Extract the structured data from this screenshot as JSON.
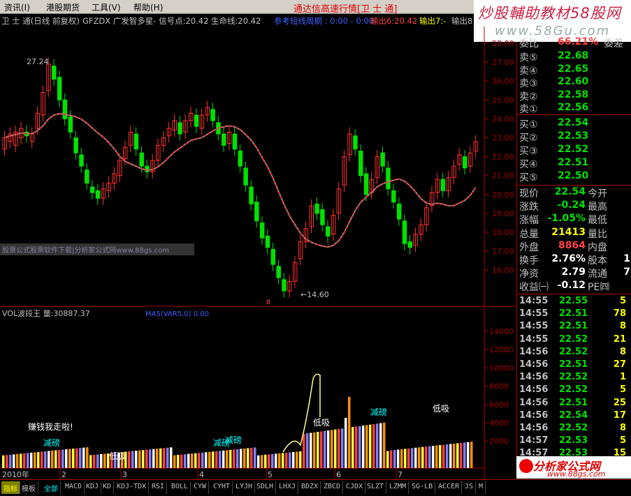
{
  "menu": [
    {
      "label": "资讯(I)"
    },
    {
      "label": "港股期货"
    },
    {
      "label": "工具(V)"
    },
    {
      "label": "帮助(H)"
    }
  ],
  "app_title": "通达信高速行情[卫 士 通]",
  "watermark": {
    "line1": "炒股輔助教材58股网",
    "line2": "www.58Gu.com"
  },
  "chart_header": {
    "stock": "卫 士 通(日线 前复权)",
    "formula": "GFZDX 广发智多星- 信号点:20.42 生命线:20.42",
    "blue_text": "参考短线周期 : 0:00 - 0:00",
    "sell1": "输出6:20.42",
    "sell2": "输出7:-",
    "sell3": "输出8"
  },
  "price_axis": [
    "28.00",
    "27.00",
    "26.00",
    "25.00",
    "24.00",
    "23.00",
    "22.00",
    "21.00",
    "20.00",
    "19.00",
    "18.00",
    "17.00",
    "16.00"
  ],
  "vol_axis": [
    "14000",
    "12000",
    "10000",
    "8000",
    "6000",
    "4000",
    "2000"
  ],
  "annotations": {
    "high_label": "27.24",
    "low_label": "←14.60",
    "ad_text": "股票公式股票软件下载|分析家公式网www.88gs.com",
    "vol_title": "VOL波段王 量:30887.37",
    "vol_blue": "MA5(VAR5,0) 0.00",
    "year": "2010年",
    "months": [
      "2",
      "3",
      "4",
      "5",
      "6",
      "7"
    ],
    "b_mark": "B",
    "vol_texts": [
      {
        "text": "赚钱我走啦!",
        "color": "#ffffff"
      },
      {
        "text": "减磅",
        "color": "#00ffff"
      },
      {
        "text": "低吸",
        "color": "#ffffff"
      },
      {
        "text": "减磅",
        "color": "#00ffff"
      },
      {
        "text": "减磅",
        "color": "#00ffff"
      },
      {
        "text": "低吸",
        "color": "#ffffff"
      },
      {
        "text": "减磅",
        "color": "#00ffff"
      },
      {
        "text": "低吸",
        "color": "#ffffff"
      }
    ]
  },
  "quote": {
    "ratio_label": "委比",
    "ratio_value": "66.21%",
    "ratio_diff": "委差",
    "asks": [
      {
        "label": "卖⑤",
        "price": "22.68"
      },
      {
        "label": "卖④",
        "price": "22.65"
      },
      {
        "label": "卖③",
        "price": "22.60"
      },
      {
        "label": "卖②",
        "price": "22.58"
      },
      {
        "label": "卖①",
        "price": "22.56"
      }
    ],
    "bids": [
      {
        "label": "买①",
        "price": "22.54"
      },
      {
        "label": "买②",
        "price": "22.53"
      },
      {
        "label": "买③",
        "price": "22.52"
      },
      {
        "label": "买④",
        "price": "22.51"
      },
      {
        "label": "买⑤",
        "price": "22.50"
      }
    ],
    "stats": [
      {
        "l1": "现价",
        "v1": "22.54",
        "c1": "green",
        "l2": "今开"
      },
      {
        "l1": "涨跌",
        "v1": "-0.24",
        "c1": "green",
        "l2": "最高"
      },
      {
        "l1": "涨幅",
        "v1": "-1.05%",
        "c1": "green",
        "l2": "最低"
      },
      {
        "l1": "总量",
        "v1": "21413",
        "c1": "yellow",
        "l2": "量比"
      },
      {
        "l1": "外盘",
        "v1": "8864",
        "c1": "red",
        "l2": "内盘"
      },
      {
        "l1": "换手",
        "v1": "2.76%",
        "c1": "white",
        "l2": "股本",
        "v2": "1"
      },
      {
        "l1": "净资",
        "v1": "2.79",
        "c1": "white",
        "l2": "流通",
        "v2": "7"
      },
      {
        "l1": "收益㈠",
        "v1": "-0.12",
        "c1": "white",
        "l2": "PE㈣"
      }
    ],
    "ticks": [
      {
        "t": "14:55",
        "p": "22.55",
        "v": "5"
      },
      {
        "t": "14:55",
        "p": "22.51",
        "v": "78"
      },
      {
        "t": "14:55",
        "p": "22.51",
        "v": "8"
      },
      {
        "t": "14:55",
        "p": "22.52",
        "v": "21"
      },
      {
        "t": "14:56",
        "p": "22.52",
        "v": "8"
      },
      {
        "t": "14:56",
        "p": "22.51",
        "v": "27"
      },
      {
        "t": "14:56",
        "p": "22.52",
        "v": "1"
      },
      {
        "t": "14:56",
        "p": "22.52",
        "v": "5"
      },
      {
        "t": "14:56",
        "p": "22.51",
        "v": "25"
      },
      {
        "t": "14:56",
        "p": "22.54",
        "v": "17"
      },
      {
        "t": "14:56",
        "p": "22.52",
        "v": "8"
      },
      {
        "t": "14:57",
        "p": "22.53",
        "v": "5"
      },
      {
        "t": "14:57",
        "p": "22.53",
        "v": "15"
      }
    ]
  },
  "logo": {
    "line1": "分析家公式网",
    "line2": "www.88gs.com"
  },
  "tabs": [
    "指标",
    "模板",
    "全部",
    "MACD",
    "KDJ",
    "KD",
    "KDJ-TDX",
    "RSI",
    "BOLL",
    "CYW",
    "CYHT",
    "LYJH",
    "SDLH",
    "LHXJ",
    "BDZX",
    "ZBCD",
    "CJDX",
    "SLZT",
    "LZMM",
    "SG-LB",
    "ACCER",
    "JS",
    "M"
  ]
}
